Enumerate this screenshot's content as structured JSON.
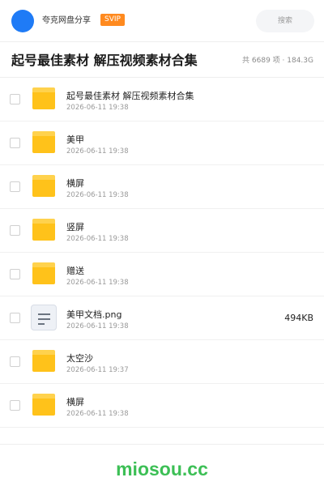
{
  "header": {
    "user_name": "夸克网盘分享",
    "badge": "SVIP",
    "search_label": "搜索"
  },
  "folder": {
    "title": "起号最佳素材 解压视频素材合集",
    "stats": "共 6689 项 · 184.3G"
  },
  "items": [
    {
      "name": "起号最佳素材 解压视频素材合集",
      "date": "2026-06-11 19:38",
      "type": "folder",
      "size": ""
    },
    {
      "name": "美甲",
      "date": "2026-06-11 19:38",
      "type": "folder",
      "size": ""
    },
    {
      "name": "横屏",
      "date": "2026-06-11 19:38",
      "type": "folder",
      "size": ""
    },
    {
      "name": "竖屏",
      "date": "2026-06-11 19:38",
      "type": "folder",
      "size": ""
    },
    {
      "name": "赠送",
      "date": "2026-06-11 19:38",
      "type": "folder",
      "size": ""
    },
    {
      "name": "美甲文档.png",
      "date": "2026-06-11 19:38",
      "type": "file",
      "size": "494KB"
    },
    {
      "name": "太空沙",
      "date": "2026-06-11 19:37",
      "type": "folder",
      "size": ""
    },
    {
      "name": "横屏",
      "date": "2026-06-11 19:38",
      "type": "folder",
      "size": ""
    }
  ],
  "footer": {
    "watermark": "miosou.cc"
  },
  "colors": {
    "accent": "#1f7bf6",
    "badge": "#ff8a1f",
    "folder": "#ffc21a",
    "watermark": "#3cbf55"
  }
}
